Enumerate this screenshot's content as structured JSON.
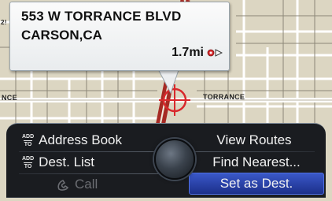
{
  "map": {
    "street_label_left": "NCE",
    "street_label_right": "TORRANCE",
    "street_label_corner": "2!"
  },
  "callout": {
    "address_line1": "553 W TORRANCE BLVD",
    "address_line2": "CARSON,CA",
    "distance": "1.7mi"
  },
  "panel": {
    "add_to_top": "ADD",
    "add_to_bottom": "TO",
    "address_book": "Address Book",
    "dest_list": "Dest. List",
    "call": "Call",
    "view_routes": "View Routes",
    "find_nearest": "Find Nearest...",
    "set_as_dest": "Set as Dest."
  },
  "colors": {
    "map_bg": "#dcd6c2",
    "road": "#ffffff",
    "highlight_button": "#2a44b0",
    "cursor": "#d8282c"
  },
  "icons": [
    "direction-icon",
    "phone-icon",
    "crosshair-cursor-icon",
    "joystick-knob-icon"
  ]
}
